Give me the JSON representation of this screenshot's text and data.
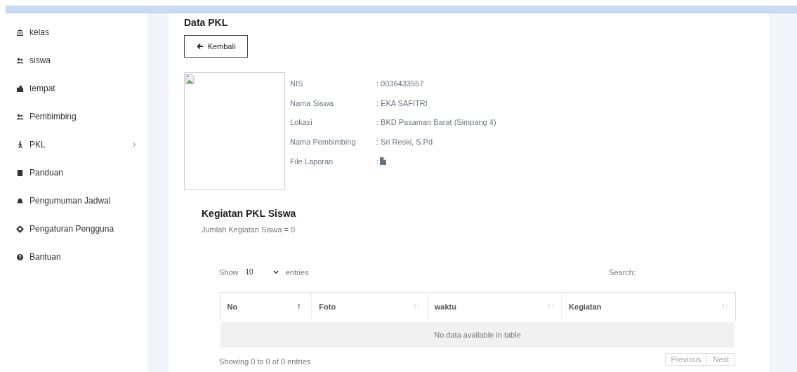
{
  "sidebar": {
    "items": [
      {
        "label": "kelas",
        "kind": "bank",
        "has_submenu": false
      },
      {
        "label": "siswa",
        "kind": "users",
        "has_submenu": false
      },
      {
        "label": "tempat",
        "kind": "building",
        "has_submenu": false
      },
      {
        "label": "Pembimbing",
        "kind": "users",
        "has_submenu": false
      },
      {
        "label": "PKL",
        "kind": "walk",
        "has_submenu": true
      },
      {
        "label": "Panduan",
        "kind": "book",
        "has_submenu": false
      },
      {
        "label": "Pengumuman Jadwal",
        "kind": "bell",
        "has_submenu": false
      },
      {
        "label": "Pengaturan Pengguna",
        "kind": "gear",
        "has_submenu": false
      },
      {
        "label": "Bantuan",
        "kind": "help",
        "has_submenu": false
      }
    ]
  },
  "page": {
    "title": "Data PKL",
    "back_button": "Kembali"
  },
  "profile": {
    "fields": [
      {
        "label": "NIS",
        "value": ": 0036433557",
        "kind": "text"
      },
      {
        "label": "Nama Siswa",
        "value": ": EKA SAFITRI",
        "kind": "text"
      },
      {
        "label": "Lokasi",
        "value": ": BKD Pasaman Barat (Simpang 4)",
        "kind": "text"
      },
      {
        "label": "Nama Pembimbing",
        "value": ": Sri Reski, S.Pd",
        "kind": "text"
      },
      {
        "label": "File Laporan",
        "value": ":",
        "kind": "file"
      }
    ]
  },
  "activities": {
    "title": "Kegiatan PKL Siswa",
    "count_text": "Jumlah Kegiatan Siswa = 0",
    "length": {
      "prefix": "Show",
      "value": "10",
      "suffix": "entries"
    },
    "search": {
      "label": "Search:"
    },
    "table": {
      "columns": [
        {
          "label": "No",
          "sorted": true
        },
        {
          "label": "Foto",
          "sorted": false
        },
        {
          "label": "waktu",
          "sorted": false
        },
        {
          "label": "Kegiatan",
          "sorted": false
        }
      ],
      "empty_text": "No data available in table"
    },
    "info": "Showing 0 to 0 of 0 entries",
    "pagination": [
      {
        "label": "Previous",
        "disabled": true
      },
      {
        "label": "Next",
        "disabled": true
      }
    ]
  }
}
